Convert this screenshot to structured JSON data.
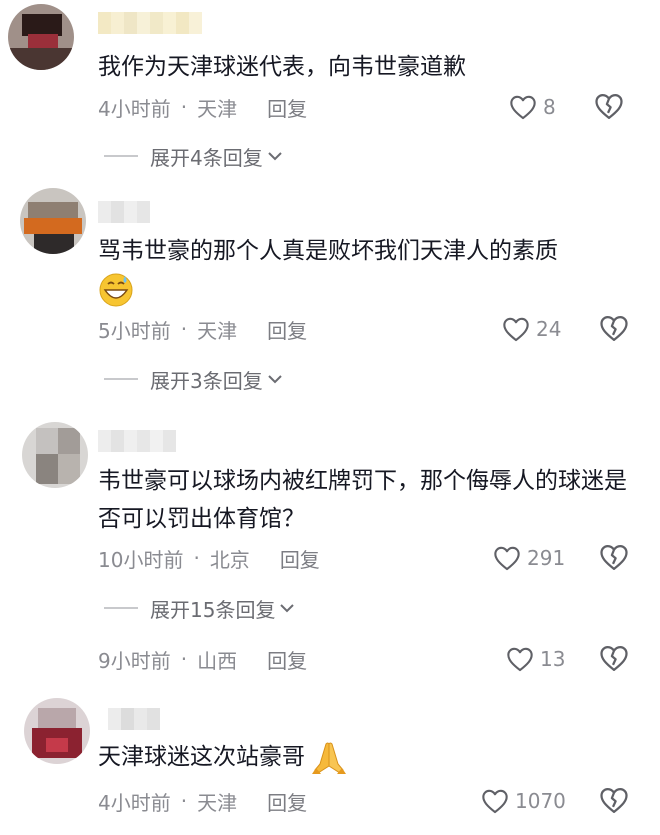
{
  "comments": [
    {
      "text": "我作为天津球迷代表，向韦世豪道歉",
      "time": "4小时前",
      "location": "天津",
      "reply_label": "回复",
      "likes": "8",
      "expand_label": "展开4条回复"
    },
    {
      "text": "骂韦世豪的那个人真是败坏我们天津人的素质",
      "emoji": "grinning-sweat-emoji",
      "time": "5小时前",
      "location": "天津",
      "reply_label": "回复",
      "likes": "24",
      "expand_label": "展开3条回复"
    },
    {
      "text": "韦世豪可以球场内被红牌罚下，那个侮辱人的球迷是否可以罚出体育馆？",
      "time": "10小时前",
      "location": "北京",
      "reply_label": "回复",
      "likes": "291",
      "expand_label": "展开15条回复"
    },
    {
      "time": "9小时前",
      "location": "山西",
      "reply_label": "回复",
      "likes": "13"
    },
    {
      "text": "天津球迷这次站豪哥",
      "emoji": "folded-hands-emoji",
      "time": "4小时前",
      "location": "天津",
      "reply_label": "回复",
      "likes": "1070"
    }
  ],
  "separator": "·",
  "icons": {
    "like": "heart-outline-icon",
    "dislike": "broken-heart-icon",
    "expand": "chevron-down-icon"
  },
  "colors": {
    "text": "#161823",
    "meta": "#8a8b91",
    "icon": "#5f6066"
  }
}
